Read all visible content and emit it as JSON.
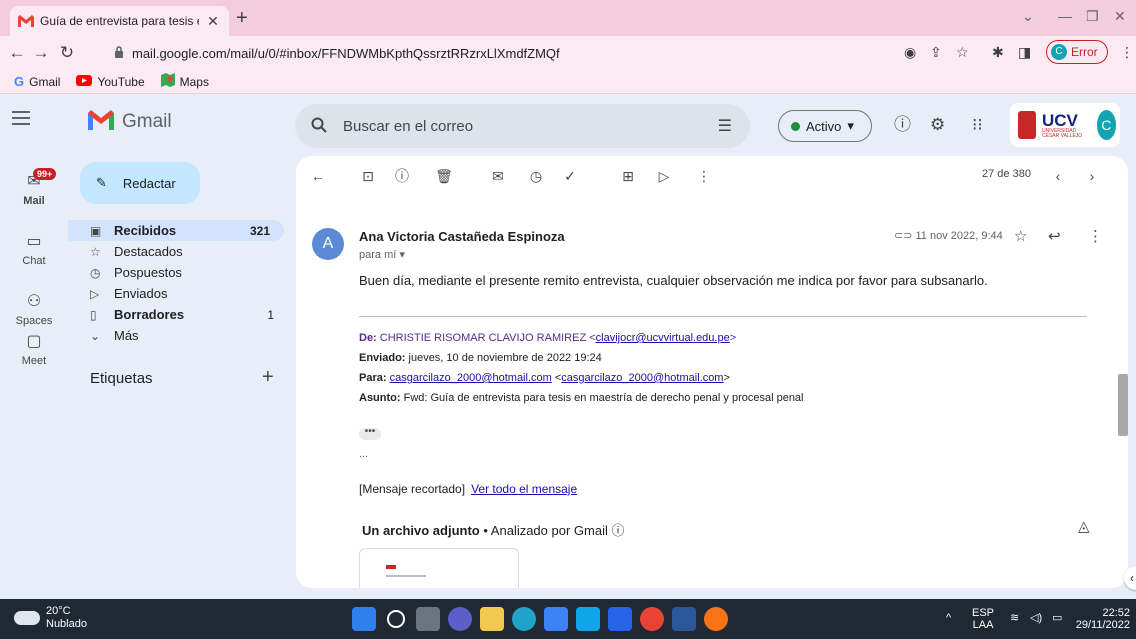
{
  "browser": {
    "tab_title": "Guía de entrevista para tesis en m",
    "tab_close": "✕",
    "new_tab": "+",
    "url": "mail.google.com/mail/u/0/#inbox/FFNDWMbKpthQssrztRRzrxLlXmdfZMQf",
    "profile_initial": "C",
    "profile_status": "Error",
    "bookmarks": [
      "Gmail",
      "YouTube",
      "Maps"
    ]
  },
  "header": {
    "app_name": "Gmail",
    "search_placeholder": "Buscar en el correo",
    "status": "Activo",
    "account_initial": "C",
    "org_name": "UCV",
    "org_subtitle": "UNIVERSIDAD CÉSAR VALLEJO"
  },
  "rail": {
    "mail_badge": "99+",
    "items": [
      "Mail",
      "Chat",
      "Spaces",
      "Meet"
    ]
  },
  "nav": {
    "compose": "Redactar",
    "items": [
      {
        "label": "Recibidos",
        "count": "321"
      },
      {
        "label": "Destacados",
        "count": ""
      },
      {
        "label": "Pospuestos",
        "count": ""
      },
      {
        "label": "Enviados",
        "count": ""
      },
      {
        "label": "Borradores",
        "count": "1"
      },
      {
        "label": "Más",
        "count": ""
      }
    ],
    "labels_title": "Etiquetas"
  },
  "message": {
    "pager": "27 de 380",
    "sender": "Ana Victoria Castañeda Espinoza",
    "avatar": "A",
    "to": "para mí ▾",
    "date": "11 nov 2022, 9:44",
    "body": "Buen día, mediante el presente remito entrevista, cualquier observación me indica por favor para subsanarlo.",
    "fwd": {
      "from_label": "De:",
      "from_name": " CHRISTIE RISOMAR CLAVIJO RAMIREZ <",
      "from_email": "clavijocr@ucvvirtual.edu.pe",
      "sent_label": "Enviado:",
      "sent": " jueves, 10 de noviembre de 2022 19:24",
      "to_label": "Para:",
      "to_email1": "casgarcilazo_2000@hotmail.com",
      "to_email2": "casgarcilazo_2000@hotmail.com",
      "subject_label": "Asunto:",
      "subject": " Fwd: Guía de entrevista para tesis en maestría de derecho penal y procesal penal"
    },
    "dots": "...",
    "trimmed": "[Mensaje recortado]",
    "view_all": "Ver todo el mensaje",
    "attachment_title": "Un archivo adjunto",
    "attachment_scan": "Analizado por Gmail"
  },
  "taskbar": {
    "temp": "20°C",
    "weather": "Nublado",
    "lang1": "ESP",
    "lang2": "LAA",
    "time": "22:52",
    "date": "29/11/2022"
  },
  "colors": {
    "accent": "#c2e7ff",
    "active_nav": "#d3e3fd",
    "tab_bar": "#f3ccdd"
  }
}
